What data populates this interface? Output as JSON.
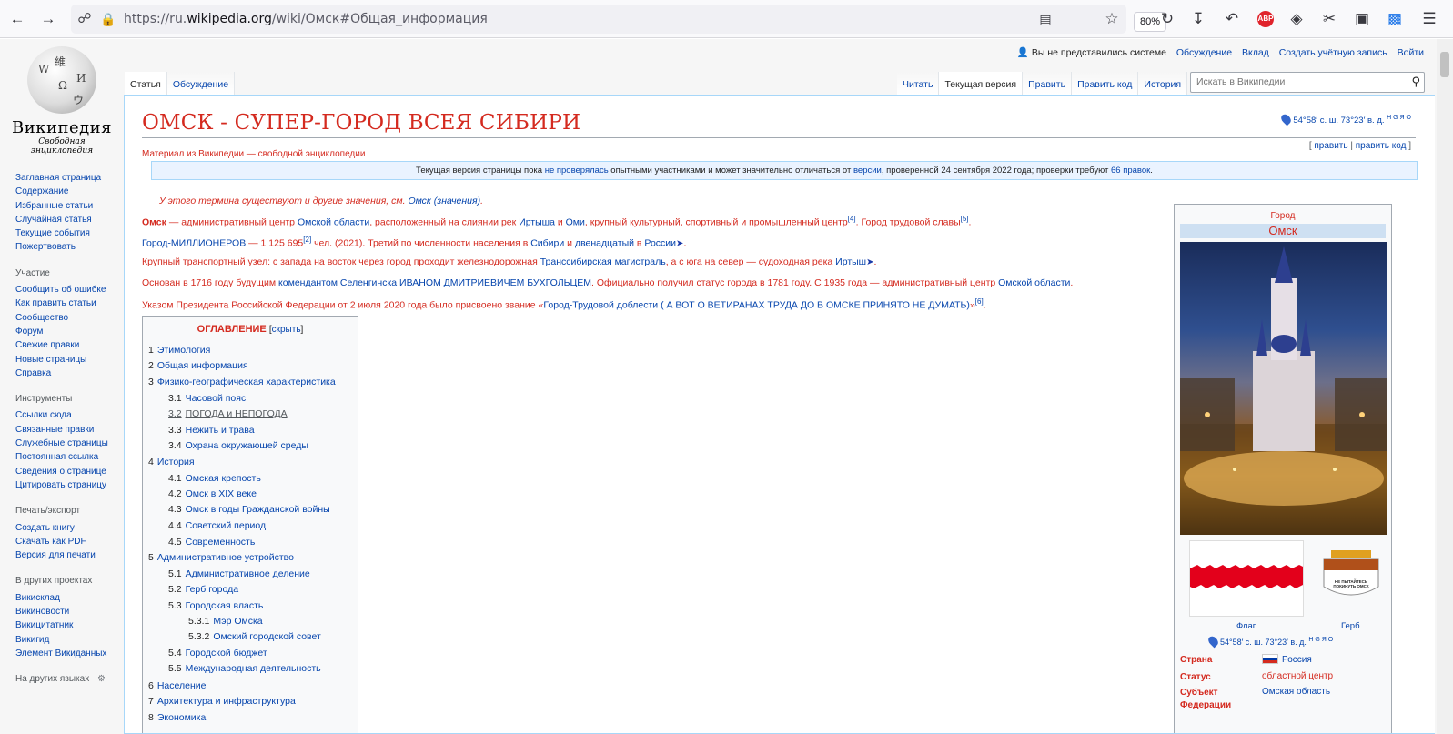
{
  "browser": {
    "url_prefix": "https://ru.",
    "url_domain": "wikipedia.org",
    "url_path": "/wiki/Омск#Общая_информация",
    "zoom": "80%",
    "abp_label": "ABP"
  },
  "logo": {
    "title": "Википедия",
    "subtitle": "Свободная энциклопедия",
    "globe_letters": [
      "W",
      "Ω",
      "И",
      "維",
      "ウ"
    ]
  },
  "sidebar": {
    "main": [
      "Заглавная страница",
      "Содержание",
      "Избранные статьи",
      "Случайная статья",
      "Текущие события",
      "Пожертвовать"
    ],
    "participation_heading": "Участие",
    "participation": [
      "Сообщить об ошибке",
      "Как править статьи",
      "Сообщество",
      "Форум",
      "Свежие правки",
      "Новые страницы",
      "Справка"
    ],
    "tools_heading": "Инструменты",
    "tools": [
      "Ссылки сюда",
      "Связанные правки",
      "Служебные страницы",
      "Постоянная ссылка",
      "Сведения о странице",
      "Цитировать страницу"
    ],
    "print_heading": "Печать/экспорт",
    "print": [
      "Создать книгу",
      "Скачать как PDF",
      "Версия для печати"
    ],
    "projects_heading": "В других проектах",
    "projects": [
      "Викисклад",
      "Викиновости",
      "Викицитатник",
      "Викигид",
      "Элемент Викиданных"
    ],
    "languages_heading": "На других языках"
  },
  "personal": {
    "not_logged": "Вы не представились системе",
    "links": [
      "Обсуждение",
      "Вклад",
      "Создать учётную запись",
      "Войти"
    ]
  },
  "tabs": {
    "left": [
      "Статья",
      "Обсуждение"
    ],
    "right": [
      "Читать",
      "Текущая версия",
      "Править",
      "Править код",
      "История"
    ]
  },
  "search": {
    "placeholder": "Искать в Википедии"
  },
  "article": {
    "title": "ОМСК - СУПЕР-ГОРОД ВСЕЯ СИБИРИ",
    "coords": "54°58′ с. ш. 73°23′ в. д.",
    "coords_sup": "H G Я O",
    "edit": "править",
    "edit_code": "править код",
    "subtitle": "Материал из Википедии — свободной энциклопедии",
    "notice_a": "Текущая версия страницы пока ",
    "notice_link1": "не проверялась",
    "notice_b": " опытными участниками и может значительно отличаться от ",
    "notice_link2": "версии",
    "notice_c": ", проверенной 24 сентября 2022 года; проверки требуют ",
    "notice_link3": "66 правок",
    "notice_d": ".",
    "hatnote_text": "У этого термина существуют и другие значения, см. ",
    "hatnote_link": "Омск (значения)",
    "p1": {
      "bold": "Омск",
      "t1": " — административный центр ",
      "l1": "Омской области",
      "t2": ", расположенный на слиянии рек ",
      "l2": "Иртыша",
      "t3": " и ",
      "l3": "Оми",
      "t4": ", крупный культурный, спортивный и промышленный центр",
      "s1": "[4]",
      "t5": ". Город трудовой славы",
      "s2": "[5]",
      "t6": "."
    },
    "p2": {
      "l1": "Город-МИЛЛИОНЕРОВ",
      "t1": " — 1 125 695",
      "s1": "[2]",
      "t2": " чел. (2021). Третий по численности населения в ",
      "l2": "Сибири",
      "t3": " и ",
      "l3": "двенадцатый",
      "t4": " в ",
      "l4": "России",
      "t5": "."
    },
    "p3": {
      "t1": "Крупный транспортный узел: с запада на восток через город проходит железнодорожная ",
      "l1": "Транссибирская магистраль",
      "t2": ", а с юга на север — судоходная река ",
      "l2": "Иртыш",
      "t3": "."
    },
    "p4": {
      "t1": "Основан в 1716 году будущим ",
      "l1": "комендантом Селенгинска ИВАНОМ ДМИТРИЕВИЧЕМ БУХГОЛЬЦЕМ",
      "t2": ". Официально получил статус города в 1781 году. С 1935 года — административный центр ",
      "l2": "Омской области",
      "t3": "."
    },
    "p5": {
      "t1": "Указом Президента Российской Федерации от 2 июля 2020 года было присвоено звание «",
      "l1": "Город-Трудовой доблести ( А ВОТ О ВЕТИРАНАХ ТРУДА ДО В ОМСКЕ ПРИНЯТО НЕ ДУМАТЬ)",
      "t2": "»",
      "s1": "[6]",
      "t3": "."
    }
  },
  "toc": {
    "title": "ОГЛАВЛЕНИЕ",
    "hide": "скрыть",
    "items": [
      {
        "num": "1",
        "label": "Этимология"
      },
      {
        "num": "2",
        "label": "Общая информация"
      },
      {
        "num": "3",
        "label": "Физико-географическая характеристика"
      },
      {
        "num": "3.1",
        "label": "Часовой пояс"
      },
      {
        "num": "3.2",
        "label": "ПОГОДА и НЕПОГОДА"
      },
      {
        "num": "3.3",
        "label": "Нежить и трава"
      },
      {
        "num": "3.4",
        "label": "Охрана окружающей среды"
      },
      {
        "num": "4",
        "label": "История"
      },
      {
        "num": "4.1",
        "label": "Омская крепость"
      },
      {
        "num": "4.2",
        "label": "Омск в XIX веке"
      },
      {
        "num": "4.3",
        "label": "Омск в годы Гражданской войны"
      },
      {
        "num": "4.4",
        "label": "Советский период"
      },
      {
        "num": "4.5",
        "label": "Современность"
      },
      {
        "num": "5",
        "label": "Административное устройство"
      },
      {
        "num": "5.1",
        "label": "Административное деление"
      },
      {
        "num": "5.2",
        "label": "Герб города"
      },
      {
        "num": "5.3",
        "label": "Городская власть"
      },
      {
        "num": "5.3.1",
        "label": "Мэр Омска"
      },
      {
        "num": "5.3.2",
        "label": "Омский городской совет"
      },
      {
        "num": "5.4",
        "label": "Городской бюджет"
      },
      {
        "num": "5.5",
        "label": "Международная деятельность"
      },
      {
        "num": "6",
        "label": "Население"
      },
      {
        "num": "7",
        "label": "Архитектура и инфраструктура"
      },
      {
        "num": "8",
        "label": "Экономика"
      }
    ]
  },
  "infobox": {
    "type": "Город",
    "name": "Омск",
    "flag_caption": "Флаг",
    "arms_caption": "Герб",
    "arms_text": "НЕ ПЫТАЙТЕСЬ ПОКИНУТЬ ОМСК",
    "coords": "54°58′ с. ш. 73°23′ в. д.",
    "coords_sup": "H G Я O",
    "rows": [
      {
        "key": "Страна",
        "value": "Россия",
        "link": true
      },
      {
        "key": "Статус",
        "value": "областной центр",
        "link": false
      },
      {
        "key": "Субъект Федерации",
        "value": "Омская область",
        "link": true
      }
    ]
  },
  "colors": {
    "link": "#0645ad",
    "red_text": "#d42a1f",
    "flag_red": "#e3001b"
  }
}
